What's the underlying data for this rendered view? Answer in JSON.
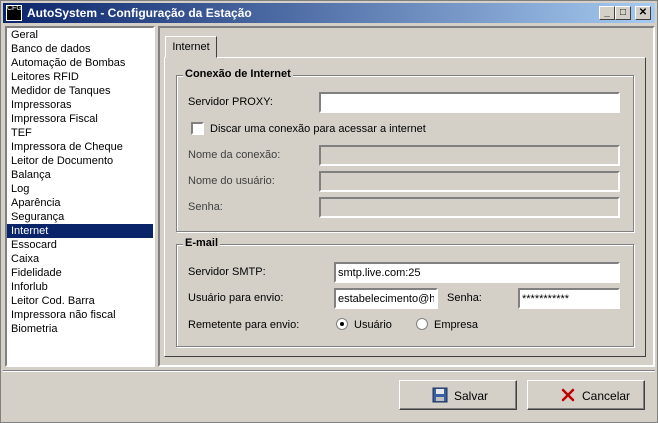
{
  "window": {
    "title": "AutoSystem - Configuração da Estação",
    "app_icon_text": "CFG",
    "controls": {
      "minimize": "_",
      "maximize": "□",
      "close": "✕"
    }
  },
  "sidebar": {
    "items": [
      "Geral",
      "Banco de dados",
      "Automação de Bombas",
      "Leitores RFID",
      "Medidor de Tanques",
      "Impressoras",
      "Impressora Fiscal",
      "TEF",
      "Impressora de Cheque",
      "Leitor de Documento",
      "Balança",
      "Log",
      "Aparência",
      "Segurança",
      "Internet",
      "Essocard",
      "Caixa",
      "Fidelidade",
      "Inforlub",
      "Leitor Cod. Barra",
      "Impressora não fiscal",
      "Biometria"
    ],
    "selected": "Internet"
  },
  "tab": {
    "label": "Internet"
  },
  "internet_group": {
    "title": "Conexão de Internet",
    "proxy_label": "Servidor PROXY:",
    "proxy_value": "",
    "dial_checkbox_label": "Discar uma conexão para acessar a internet",
    "dial_checked": false,
    "connection_name_label": "Nome da conexão:",
    "connection_name_value": "",
    "user_name_label": "Nome do usuário:",
    "user_name_value": "",
    "password_label": "Senha:",
    "password_value": ""
  },
  "email_group": {
    "title": "E-mail",
    "smtp_label": "Servidor SMTP:",
    "smtp_value": "smtp.live.com:25",
    "user_label": "Usuário para envio:",
    "user_value": "estabelecimento@hc",
    "password_label": "Senha:",
    "password_value": "***********",
    "sender_label": "Remetente para envio:",
    "sender_options": [
      "Usuário",
      "Empresa"
    ],
    "sender_selected": "Usuário"
  },
  "buttons": {
    "save": "Salvar",
    "cancel": "Cancelar"
  },
  "colors": {
    "selection": "#0a246a",
    "face": "#d4d0c8",
    "cancel_icon": "#c00000",
    "save_icon": "#3a5fa0"
  }
}
